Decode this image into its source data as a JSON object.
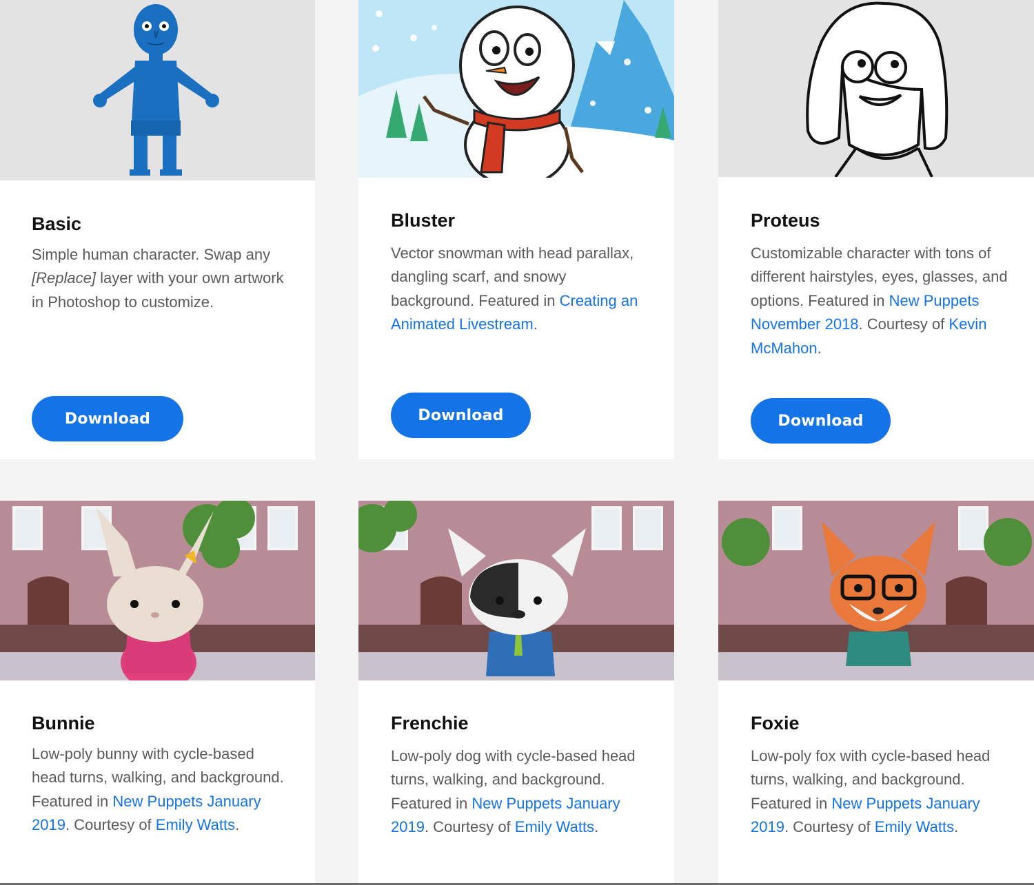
{
  "cards": [
    {
      "title": "Basic",
      "desc_1": "Simple human character. Swap any ",
      "desc_em": "[Replace]",
      "desc_2": " layer with your own artwork in Photoshop to customize.",
      "button": "Download"
    },
    {
      "title": "Bluster",
      "desc_1": "Vector snowman with head parallax, dangling scarf, and snowy background. Featured in ",
      "link_1": "Creating an Animated Livestream",
      "desc_2": ".",
      "button": "Download"
    },
    {
      "title": "Proteus",
      "desc_1": "Customizable character with tons of different hairstyles, eyes, glasses, and options. Featured in ",
      "link_1": "New Puppets November 2018",
      "desc_2": ". Courtesy of ",
      "link_2": "Kevin McMahon",
      "desc_3": ".",
      "button": "Download"
    },
    {
      "title": "Bunnie",
      "desc_1": "Low-poly bunny with cycle-based head turns, walking, and background. Featured in ",
      "link_1": "New Puppets January 2019",
      "desc_2": ". Courtesy of ",
      "link_2": "Emily Watts",
      "desc_3": "."
    },
    {
      "title": "Frenchie",
      "desc_1": "Low-poly dog with cycle-based head turns, walking, and background. Featured in ",
      "link_1": "New Puppets January 2019",
      "desc_2": ". Courtesy of ",
      "link_2": "Emily Watts",
      "desc_3": "."
    },
    {
      "title": "Foxie",
      "desc_1": "Low-poly fox with cycle-based head turns, walking, and background. Featured in ",
      "link_1": "New Puppets January 2019",
      "desc_2": ". Courtesy of ",
      "link_2": "Emily Watts",
      "desc_3": "."
    }
  ],
  "colors": {
    "accent": "#1473e6",
    "page_bg": "#f4f4f4",
    "card_bg": "#ffffff",
    "title": "#111111",
    "body_text": "#5a5a5a"
  }
}
